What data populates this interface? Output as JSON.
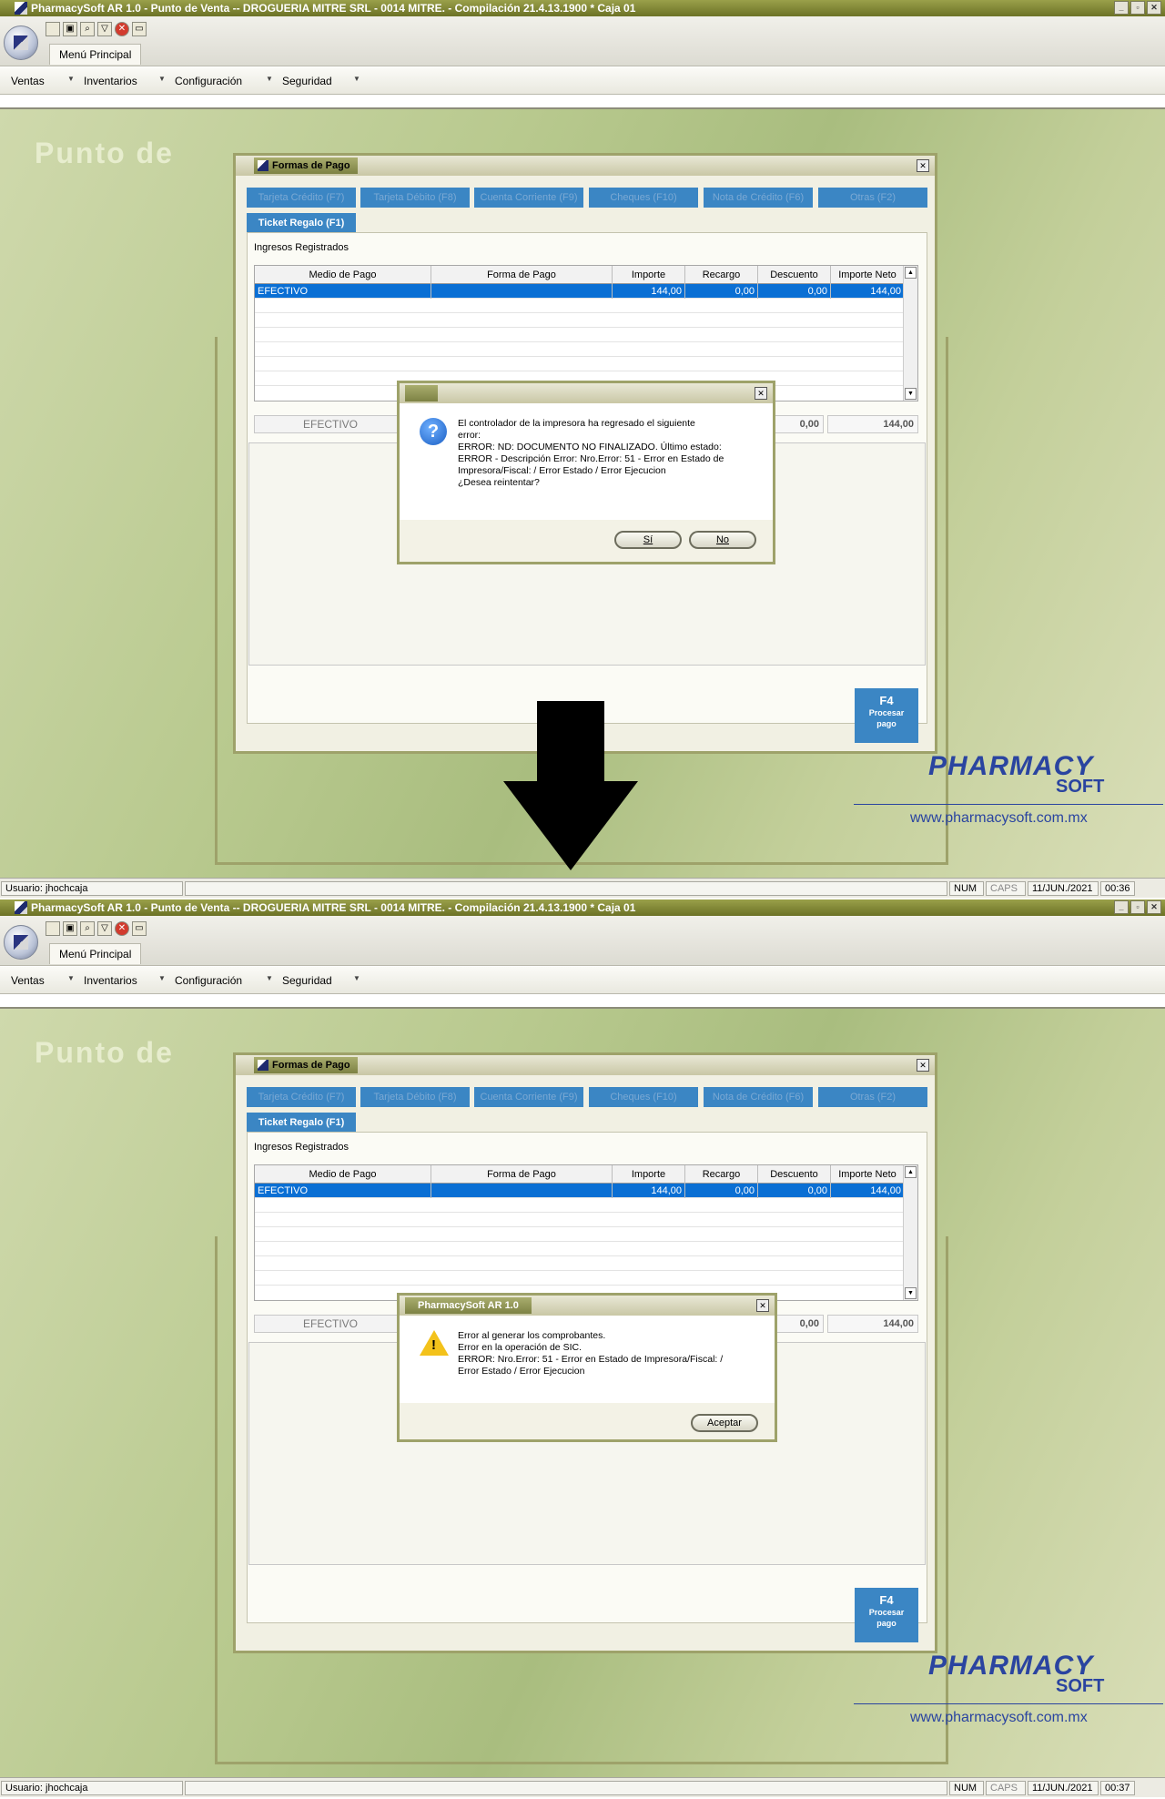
{
  "window": {
    "title": "PharmacySoft AR 1.0 - Punto de Venta -- DROGUERIA MITRE SRL - 0014 MITRE. -  Compilación 21.4.13.1900 * Caja 01"
  },
  "ribbon": {
    "tab": "Menú Principal"
  },
  "menu": [
    {
      "label": "Ventas"
    },
    {
      "label": "Inventarios"
    },
    {
      "label": "Configuración"
    },
    {
      "label": "Seguridad"
    }
  ],
  "desktop": {
    "bg_text": "Punto de",
    "brand_line1": "PHARMACY",
    "brand_line2": "SOFT",
    "brand_url": "www.pharmacysoft.com.mx"
  },
  "formas": {
    "title": "Formas de Pago",
    "buttons": [
      "Tarjeta Crédito (F7)",
      "Tarjeta Débito (F8)",
      "Cuenta Corriente (F9)",
      "Cheques (F10)",
      "Nota de Crédito (F6)",
      "Otras (F2)"
    ],
    "ticket_regalo": "Ticket Regalo (F1)",
    "group_label": "Ingresos Registrados",
    "columns": [
      "Medio de Pago",
      "Forma de Pago",
      "Importe",
      "Recargo",
      "Descuento",
      "Importe Neto"
    ],
    "row": [
      "EFECTIVO",
      "",
      "144,00",
      "0,00",
      "0,00",
      "144,00"
    ],
    "efectivo_label": "EFECTIVO",
    "total_descuento": "0,00",
    "total_neto": "144,00",
    "f4_key": "F4",
    "f4_label1": "Procesar",
    "f4_label2": "pago"
  },
  "dialog1": {
    "title": "",
    "lines": [
      "El controlador de la impresora ha regresado el siguiente",
      "error:",
      "ERROR: ND: DOCUMENTO NO FINALIZADO. Último estado:",
      "ERROR - Descripción Error: Nro.Error: 51 - Error en Estado de",
      "Impresora/Fiscal:  / Error Estado / Error Ejecucion",
      "¿Desea reintentar?"
    ],
    "yes": "Sí",
    "no": "No"
  },
  "dialog2": {
    "title": "PharmacySoft AR 1.0",
    "lines": [
      "Error al generar los comprobantes.",
      "Error en la operación de SIC.",
      "ERROR: Nro.Error: 51 - Error en Estado de Impresora/Fiscal:  /",
      "Error Estado / Error Ejecucion"
    ],
    "ok": "Aceptar"
  },
  "status_top": {
    "user": "Usuario: jhochcaja",
    "num": "NUM",
    "caps": "CAPS",
    "date": "11/JUN./2021",
    "time": "00:36"
  },
  "status_bottom": {
    "user": "Usuario: jhochcaja",
    "num": "NUM",
    "caps": "CAPS",
    "date": "11/JUN./2021",
    "time": "00:37"
  },
  "icons": {
    "question": "question-icon",
    "warning": "warning-icon",
    "arrow": "down-arrow"
  }
}
